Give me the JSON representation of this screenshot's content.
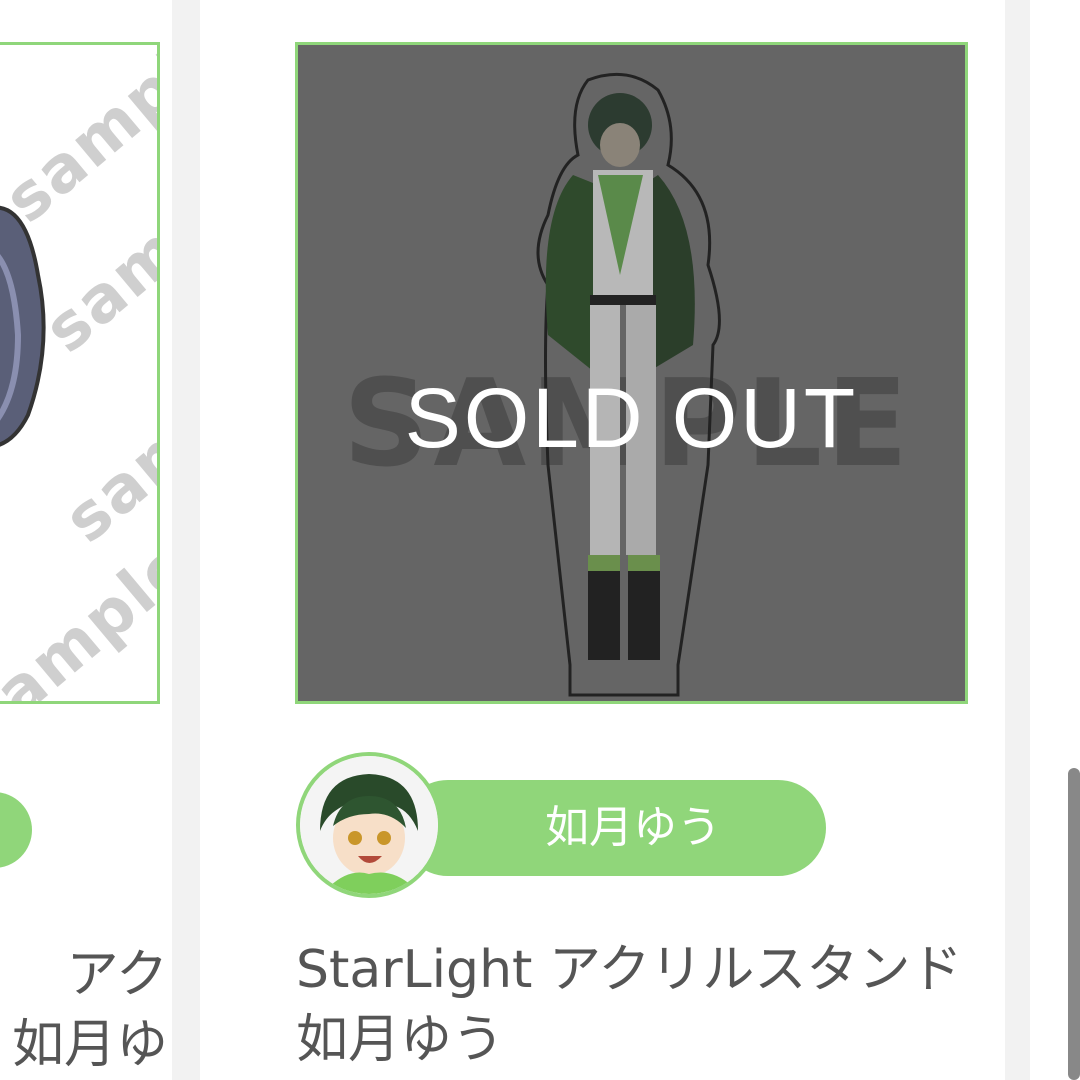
{
  "left_card": {
    "watermark": "sample",
    "title_partial_line1": "アク",
    "title_partial_line2": "如月ゆ"
  },
  "main_card": {
    "watermark": "SAMPLE",
    "status_overlay": "SOLD OUT",
    "creator_name": "如月ゆう",
    "title": "StarLight アクリルスタンド 如月ゆう"
  },
  "colors": {
    "accent_green": "#90d67a",
    "overlay_gray": "#656565",
    "text_gray": "#555555"
  }
}
